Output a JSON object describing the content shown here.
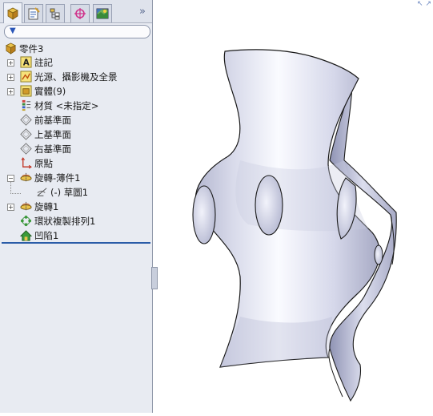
{
  "tabs": [
    {
      "name": "featuremanager-icon"
    },
    {
      "name": "propertymanager-icon"
    },
    {
      "name": "configurationmanager-icon"
    },
    {
      "name": "dimxpert-icon"
    },
    {
      "name": "display-manager-icon"
    }
  ],
  "tree": {
    "root": "零件3",
    "items": [
      {
        "label": "註記",
        "icon": "annotations-icon",
        "expandable": true
      },
      {
        "label": "光源、攝影機及全景",
        "icon": "lights-cameras-icon",
        "expandable": true
      },
      {
        "label": "實體(9)",
        "icon": "solid-bodies-icon",
        "expandable": true
      },
      {
        "label": "材質 <未指定>",
        "icon": "material-icon",
        "expandable": false
      },
      {
        "label": "前基準面",
        "icon": "plane-icon",
        "expandable": false
      },
      {
        "label": "上基準面",
        "icon": "plane-icon",
        "expandable": false
      },
      {
        "label": "右基準面",
        "icon": "plane-icon",
        "expandable": false
      },
      {
        "label": "原點",
        "icon": "origin-icon",
        "expandable": false
      },
      {
        "label": "旋轉-薄件1",
        "icon": "revolve-thin-icon",
        "expandable": true,
        "expanded": true
      },
      {
        "label": "(-) 草圖1",
        "icon": "sketch-icon",
        "expandable": false,
        "child": true
      },
      {
        "label": "旋轉1",
        "icon": "revolve-icon",
        "expandable": true
      },
      {
        "label": "環狀複製排列1",
        "icon": "circular-pattern-icon",
        "expandable": false
      },
      {
        "label": "凹陷1",
        "icon": "indent-icon",
        "expandable": false
      }
    ]
  },
  "colors": {
    "panel": "#e8ebf2",
    "rollback_bar": "#2a5ca8",
    "model": "#e4e6f4"
  }
}
